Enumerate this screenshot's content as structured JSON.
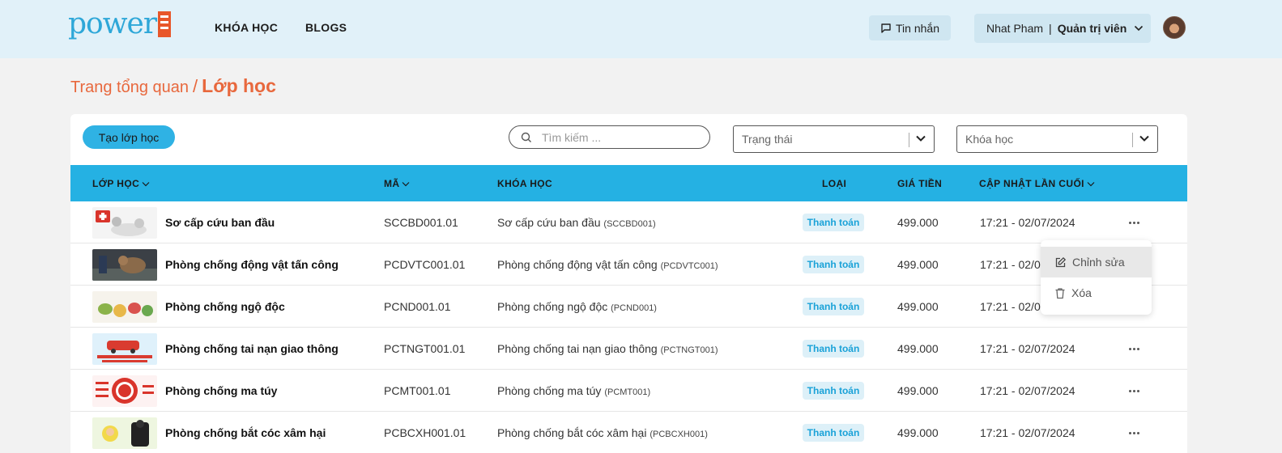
{
  "header": {
    "logo_text": "power",
    "nav": [
      "KHÓA HỌC",
      "BLOGS"
    ],
    "messages_label": "Tin nhắn",
    "user_name": "Nhat Pham",
    "user_separator": "|",
    "user_role": "Quản trị viên"
  },
  "breadcrumb": {
    "home": "Trang tổng quan",
    "separator": "/",
    "current": "Lớp học"
  },
  "toolbar": {
    "create_label": "Tạo lớp học",
    "search_placeholder": "Tìm kiếm ...",
    "status_placeholder": "Trạng thái",
    "course_placeholder": "Khóa học"
  },
  "table": {
    "columns": [
      "LỚP HỌC",
      "MÃ",
      "KHÓA HỌC",
      "LOẠI",
      "GIÁ TIỀN",
      "CẬP NHẬT LẦN CUỐI"
    ],
    "rows": [
      {
        "name": "Sơ cấp cứu ban đầu",
        "code": "SCCBD001.01",
        "course": "Sơ cấp cứu ban đầu",
        "course_code": "(SCCBD001)",
        "type": "Thanh toán",
        "price": "499.000",
        "updated": "17:21 - 02/07/2024"
      },
      {
        "name": "Phòng chống động vật tấn công",
        "code": "PCDVTC001.01",
        "course": "Phòng chống động vật tấn công",
        "course_code": "(PCDVTC001)",
        "type": "Thanh toán",
        "price": "499.000",
        "updated": "17:21 - 02/0"
      },
      {
        "name": "Phòng chống ngộ độc",
        "code": "PCND001.01",
        "course": "Phòng chống ngộ độc",
        "course_code": "(PCND001)",
        "type": "Thanh toán",
        "price": "499.000",
        "updated": "17:21 - 02/0"
      },
      {
        "name": "Phòng chống tai nạn giao thông",
        "code": "PCTNGT001.01",
        "course": "Phòng chống tai nạn giao thông",
        "course_code": "(PCTNGT001)",
        "type": "Thanh toán",
        "price": "499.000",
        "updated": "17:21 - 02/07/2024"
      },
      {
        "name": "Phòng chống ma túy",
        "code": "PCMT001.01",
        "course": "Phòng chống ma túy",
        "course_code": "(PCMT001)",
        "type": "Thanh toán",
        "price": "499.000",
        "updated": "17:21 - 02/07/2024"
      },
      {
        "name": "Phòng chống bắt cóc xâm hại",
        "code": "PCBCXH001.01",
        "course": "Phòng chống bắt cóc xâm hại",
        "course_code": "(PCBCXH001)",
        "type": "Thanh toán",
        "price": "499.000",
        "updated": "17:21 - 02/07/2024"
      }
    ]
  },
  "context_menu": {
    "edit_label": "Chỉnh sửa",
    "delete_label": "Xóa"
  },
  "colors": {
    "header_bg": "#e1f1f9",
    "accent_blue": "#25b1e3",
    "breadcrumb_orange": "#e8683d",
    "badge_text": "#1aa2d8"
  }
}
